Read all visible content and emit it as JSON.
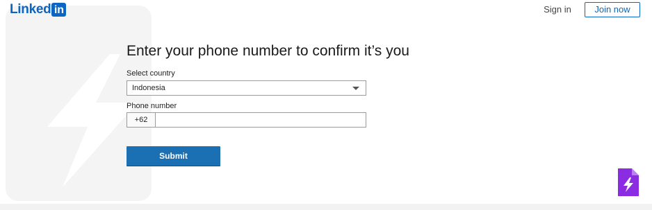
{
  "header": {
    "logo_text": "Linked",
    "logo_box_text": "in",
    "sign_in_label": "Sign in",
    "join_label": "Join now"
  },
  "main": {
    "title": "Enter your phone number to confirm it’s you",
    "country_label": "Select country",
    "country_value": "Indonesia",
    "phone_label": "Phone number",
    "phone_prefix": "+62",
    "phone_value": "",
    "submit_label": "Submit"
  },
  "colors": {
    "brand": "#0a66c2",
    "submit": "#1b6fb3",
    "badge": "#8b2be2"
  },
  "icons": {
    "watermark": "lightning-bolt-icon",
    "badge": "lightning-document-icon",
    "dropdown": "chevron-down-icon"
  }
}
